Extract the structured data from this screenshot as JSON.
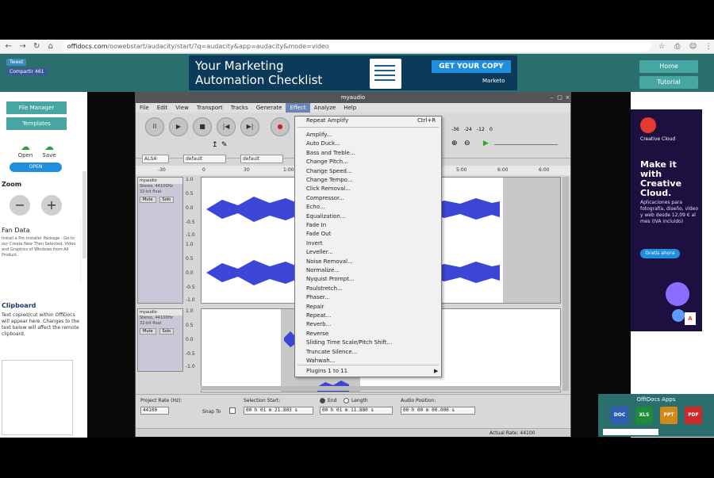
{
  "browser": {
    "url_host": "offidocs.com",
    "url_path": "/oowebstart/audacity/start/?q=audacity&app=audacity&mode=video",
    "nav": [
      "back-icon",
      "forward-icon",
      "reload-icon",
      "home-icon"
    ]
  },
  "header": {
    "social": [
      "Tweet",
      "Compartir 461"
    ],
    "ad": {
      "line1": "Your Marketing",
      "line2": "Automation Checklist",
      "cta": "GET YOUR COPY",
      "brand": "Marketo"
    },
    "nav_buttons": [
      "Home",
      "Tutorial"
    ]
  },
  "sidebar": {
    "buttons": [
      "File Manager",
      "Templates"
    ],
    "cloud": [
      "Open",
      "Save"
    ],
    "zoom_label": "Zoom",
    "zoom_minus": "−",
    "zoom_plus": "+",
    "data_title": "Fan Data",
    "data_desc": "Install a Pro installer Package - Go to our Create New Then Selected. Video and Graphics of Windows from All Product.",
    "open_button": "OPEN",
    "clipboard_title": "Clipboard",
    "clipboard_desc": "Text copied/cut within OffiDocs will appear here. Changes to the text below will affect the remote clipboard."
  },
  "audacity": {
    "title": "myaudio",
    "menu": [
      "File",
      "Edit",
      "View",
      "Transport",
      "Tracks",
      "Generate",
      "Effect",
      "Analyze",
      "Help"
    ],
    "active_menu": "Effect",
    "transport": [
      "pause-icon",
      "play-icon",
      "stop-icon",
      "skip-start-icon",
      "skip-end-icon",
      "record-icon"
    ],
    "transport_glyphs": [
      "II",
      "▶",
      "■",
      "|◀",
      "▶|",
      "●"
    ],
    "selects": [
      "ALSA",
      "default",
      "default"
    ],
    "meter_labels": [
      "-36",
      "-24",
      "-12",
      "0"
    ],
    "ruler_left": [
      "-30",
      "0",
      "30",
      "1:00"
    ],
    "ruler_right": [
      "5:00",
      "6:00",
      "6:00"
    ],
    "track1": {
      "name": "myaudio",
      "info": [
        "Stereo, 44100Hz",
        "32-bit float"
      ],
      "buttons": [
        "Mute",
        "Solo"
      ]
    },
    "track2": {
      "name": "myaudio",
      "info": [
        "Stereo, 44100Hz",
        "32-bit float"
      ],
      "buttons": [
        "Mute",
        "Solo"
      ]
    },
    "scale": [
      "1.0",
      "0.5",
      "0.0",
      "-0.5",
      "-1.0"
    ],
    "bottom": {
      "project_rate_label": "Project Rate (Hz):",
      "project_rate": "44100",
      "snap_label": "Snap To",
      "sel_start_label": "Selection Start:",
      "end_label": "End",
      "length_label": "Length",
      "audio_pos_label": "Audio Position:",
      "sel_start": "00 h 01 m 21.803 s",
      "sel_end": "00 h 01 m 11.880 s",
      "audio_pos": "00 h 00 m 00.000 s",
      "status": "Actual Rate: 44100"
    }
  },
  "effect_menu": {
    "repeat": "Repeat Amplify",
    "repeat_shortcut": "Ctrl+R",
    "items": [
      "Amplify...",
      "Auto Duck...",
      "Bass and Treble...",
      "Change Pitch...",
      "Change Speed...",
      "Change Tempo...",
      "Click Removal...",
      "Compressor...",
      "Echo...",
      "Equalization...",
      "Fade In",
      "Fade Out",
      "Invert",
      "Leveller...",
      "Noise Removal...",
      "Normalize...",
      "Nyquist Prompt...",
      "Paulstretch...",
      "Phaser...",
      "Repair",
      "Repeat...",
      "Reverb...",
      "Reverse",
      "Sliding Time Scale/Pitch Shift...",
      "Truncate Silence...",
      "Wahwah..."
    ],
    "plugins": "Plugins 1 to 11"
  },
  "right_ad": {
    "brand": "Creative Cloud",
    "headline": "Make it with Creative Cloud.",
    "desc": "Aplicaciones para fotografía, diseño, vídeo y web desde 12,09 € al mes (IVA incluido)",
    "button": "Gratis ahora",
    "adobe": "A"
  },
  "apps": {
    "title": "OffiDocs Apps",
    "icons": [
      "DOC",
      "XLS",
      "PPT",
      "PDF"
    ],
    "colors": [
      "#2b5fb4",
      "#1f8a3c",
      "#d08a1c",
      "#cc2a2a"
    ]
  }
}
